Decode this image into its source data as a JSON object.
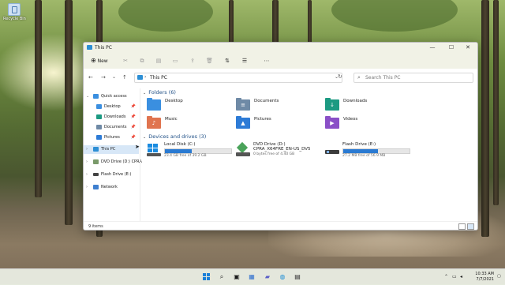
{
  "desktop": {
    "recycle_bin_label": "Recycle Bin"
  },
  "window": {
    "title": "This PC",
    "controls": {
      "minimize": "—",
      "maximize": "☐",
      "close": "✕"
    }
  },
  "toolbar": {
    "new_label": "New",
    "icons": [
      "cut-icon",
      "copy-icon",
      "paste-icon",
      "rename-icon",
      "share-icon",
      "delete-icon",
      "sort-icon",
      "view-icon",
      "more-icon"
    ]
  },
  "address": {
    "path": "This PC",
    "search_placeholder": "Search This PC"
  },
  "sidebar": {
    "quick_access": "Quick access",
    "pinned": [
      {
        "label": "Desktop"
      },
      {
        "label": "Downloads"
      },
      {
        "label": "Documents"
      },
      {
        "label": "Pictures"
      }
    ],
    "this_pc": "This PC",
    "dvd": "DVD Drive (D:) CPRA",
    "flash": "Flash Drive (E:)",
    "network": "Network"
  },
  "folders_header": "Folders (6)",
  "folders": [
    {
      "label": "Desktop",
      "color": "#3a8fe0"
    },
    {
      "label": "Documents",
      "color": "#6f8aa6"
    },
    {
      "label": "Downloads",
      "color": "#1c9a82"
    },
    {
      "label": "Music",
      "color": "#e0744f"
    },
    {
      "label": "Pictures",
      "color": "#2d7bd6"
    },
    {
      "label": "Videos",
      "color": "#8a4fc7"
    }
  ],
  "drives_header": "Devices and drives (3)",
  "drives": [
    {
      "name": "Local Disk (C:)",
      "free": "23.4 GB free of 39.2 GB",
      "used_fraction": 0.4
    },
    {
      "name": "DVD Drive (D:)",
      "name2": "CPRA_X64FRE_EN-US_DV5",
      "free": "0 bytes free of 4.40 GB"
    },
    {
      "name": "Flash Drive (E:)",
      "free": "27.2 MB free of 56.9 MB",
      "used_fraction": 0.52
    }
  ],
  "status": {
    "items": "9 items"
  },
  "taskbar": {
    "time": "10:33 AM",
    "date": "7/7/2021"
  }
}
